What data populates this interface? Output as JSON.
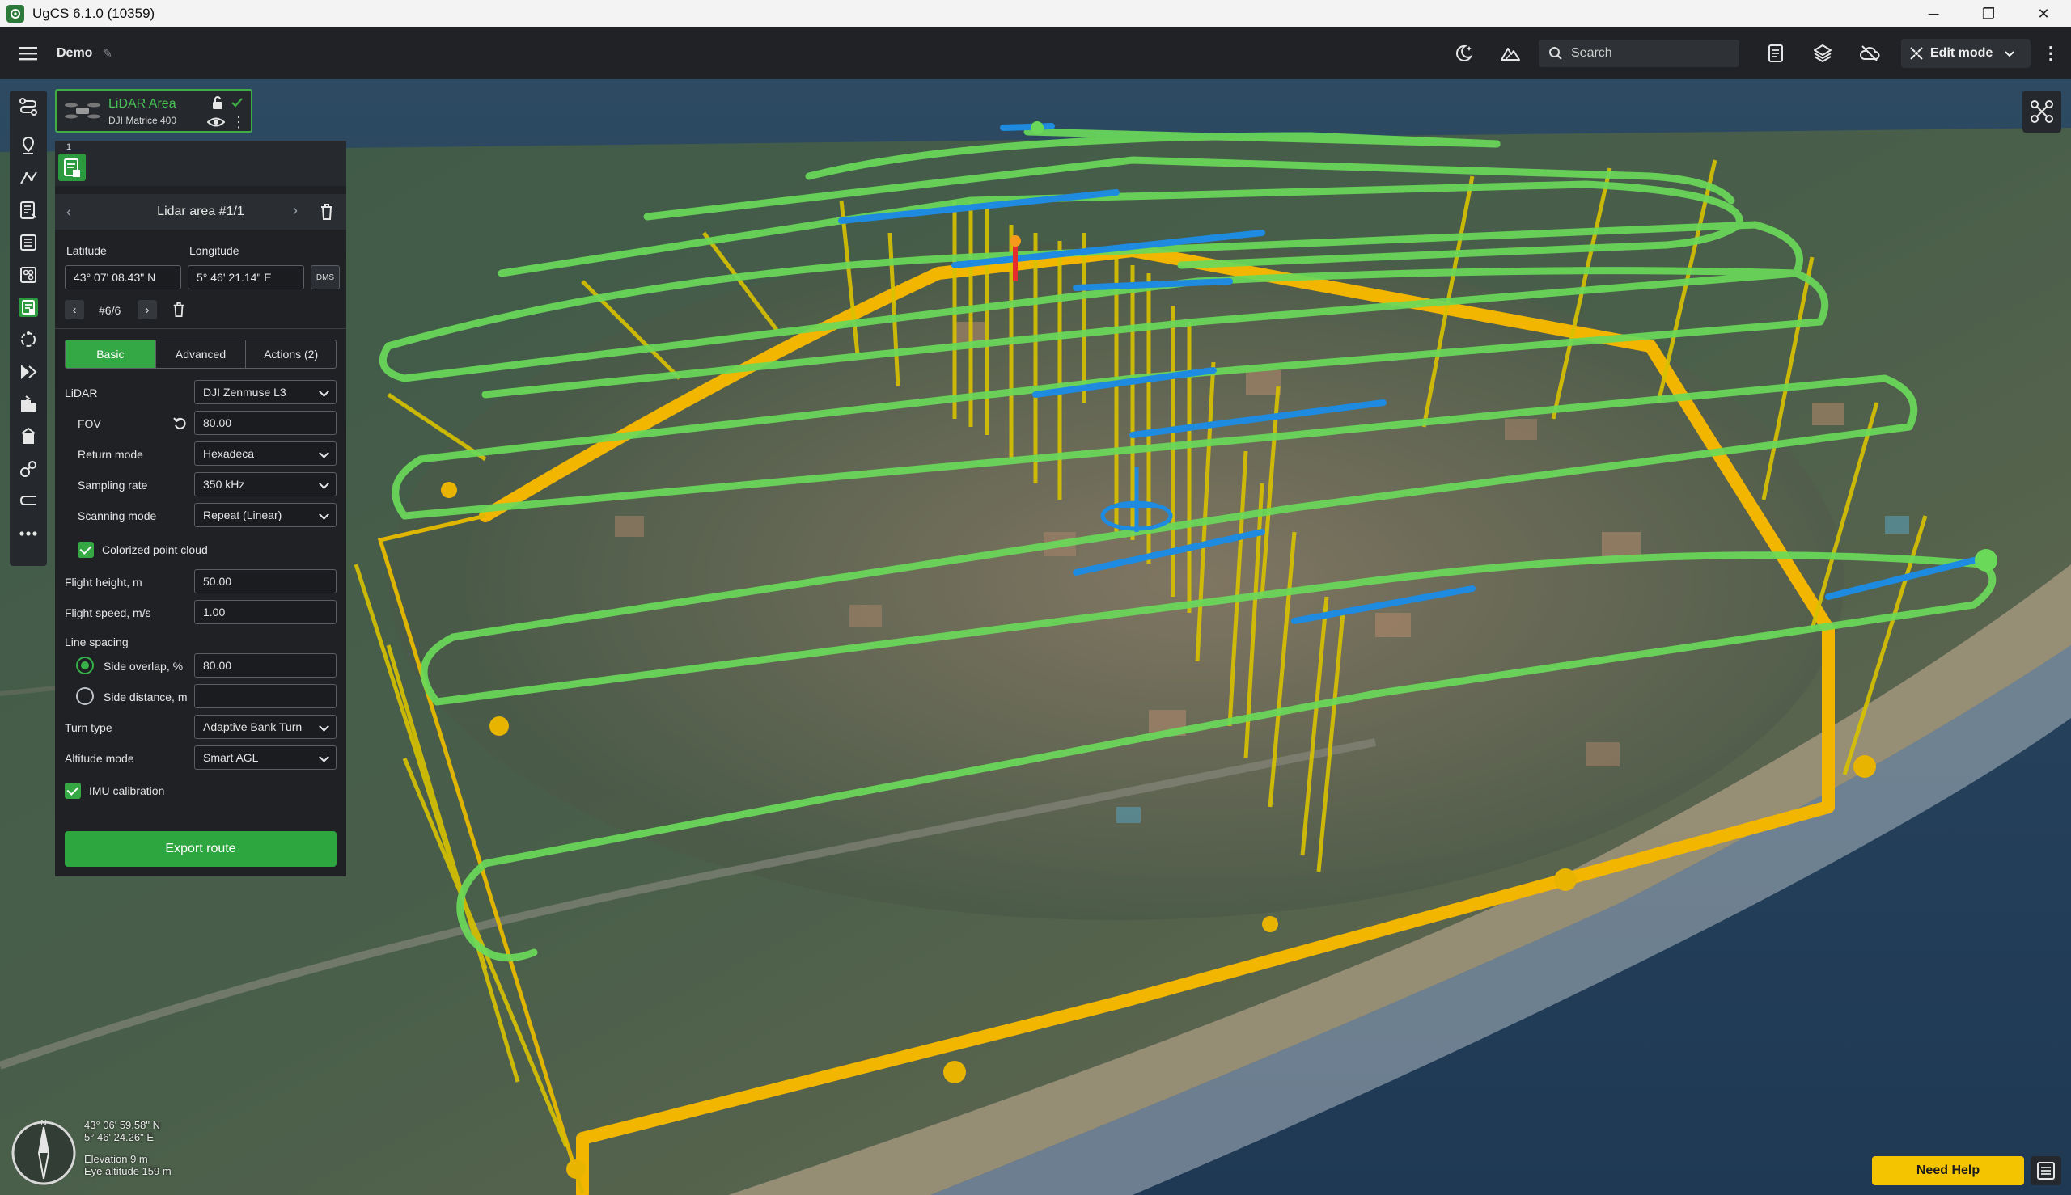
{
  "window": {
    "title": "UgCS 6.1.0 (10359)",
    "minimize": "─",
    "maximize": "❐",
    "close": "✕"
  },
  "toolbar": {
    "project_name": "Demo",
    "search_placeholder": "Search",
    "edit_mode_label": "Edit mode"
  },
  "route": {
    "name": "LiDAR Area",
    "vehicle": "DJI Matrice 400"
  },
  "segment": {
    "number": "1",
    "title": "Lidar area #1/1",
    "latitude_label": "Latitude",
    "longitude_label": "Longitude",
    "latitude": "43° 07' 08.43\" N",
    "longitude": "5° 46' 21.14\" E",
    "dms_label": "DMS",
    "vertex_counter": "#6/6"
  },
  "tabs": [
    {
      "label": "Basic",
      "active": true
    },
    {
      "label": "Advanced",
      "active": false
    },
    {
      "label": "Actions (2)",
      "active": false
    }
  ],
  "params": {
    "lidar_label": "LiDAR",
    "lidar_value": "DJI Zenmuse L3",
    "fov_label": "FOV",
    "fov_value": "80.00",
    "return_mode_label": "Return mode",
    "return_mode_value": "Hexadeca",
    "sampling_rate_label": "Sampling rate",
    "sampling_rate_value": "350 kHz",
    "scanning_mode_label": "Scanning mode",
    "scanning_mode_value": "Repeat (Linear)",
    "colorized_label": "Colorized point cloud",
    "colorized_checked": true,
    "flight_height_label": "Flight height, m",
    "flight_height_value": "50.00",
    "flight_speed_label": "Flight speed, m/s",
    "flight_speed_value": "1.00",
    "line_spacing_label": "Line spacing",
    "side_overlap_label": "Side overlap, %",
    "side_overlap_value": "80.00",
    "side_distance_label": "Side distance, m",
    "side_distance_value": "",
    "turn_type_label": "Turn type",
    "turn_type_value": "Adaptive Bank Turn",
    "altitude_mode_label": "Altitude mode",
    "altitude_mode_value": "Smart AGL",
    "imu_label": "IMU calibration",
    "imu_checked": true
  },
  "export_label": "Export route",
  "status": {
    "lat": "43° 06' 59.58\" N",
    "lon": "5° 46' 24.26\" E",
    "elevation": "Elevation 9 m",
    "eye_altitude": "Eye altitude 159 m"
  },
  "need_help_label": "Need Help",
  "colors": {
    "accent_green": "#34a845",
    "route_green": "#6ad95a",
    "path_yellow": "#f2b600",
    "lidar_blue": "#1e8be0",
    "help_yellow": "#f5c400"
  },
  "icons": {
    "menu": "hamburger-icon",
    "night": "night-mode-icon",
    "terrain": "terrain-icon",
    "search": "search-icon",
    "report": "report-icon",
    "layers": "layers-icon",
    "cloud": "cloud-icon",
    "edit_mode": "edit-mode-icon"
  }
}
